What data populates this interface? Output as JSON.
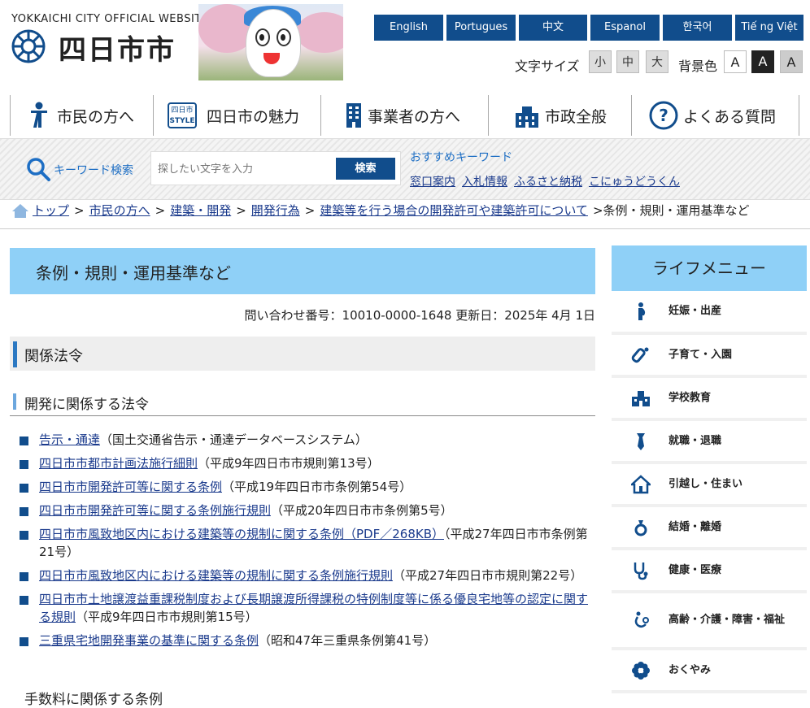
{
  "header": {
    "site_english": "YOKKAICHI CITY OFFICIAL WEBSITE",
    "site_title": "四日市市",
    "languages": [
      "English",
      "Portugues",
      "中文",
      "Espanol",
      "한국어",
      "Tiế ng Việt"
    ],
    "font_size_label": "文字サイズ",
    "font_sizes": [
      "小",
      "中",
      "大"
    ],
    "bg_label": "背景色",
    "bg_options": [
      "A",
      "A",
      "A"
    ]
  },
  "nav": {
    "items": [
      "市民の方へ",
      "四日市の魅力",
      "事業者の方へ",
      "市政全般",
      "よくある質問"
    ],
    "style_badge_top": "四日市",
    "style_badge_bottom": "STYLE"
  },
  "search": {
    "label": "キーワード検索",
    "placeholder": "探したい文字を入力",
    "button": "検索",
    "recommended_title": "おすすめキーワード",
    "recommended": [
      "窓口案内",
      "入札情報",
      "ふるさと納税",
      "こにゅうどうくん"
    ]
  },
  "breadcrumb": {
    "links": [
      "トップ",
      "市民の方へ",
      "建築・開発",
      "開発行為",
      "建築等を行う場合の開発許可や建築許可について"
    ],
    "current": "条例・規則・運用基準など",
    "separator": ">"
  },
  "page": {
    "title": "条例・規則・運用基準など",
    "meta": "問い合わせ番号：10010-0000-1648 更新日：2025年 4月 1日",
    "section_title": "関係法令",
    "subsection_title": "開発に関係する法令",
    "laws": [
      {
        "link": "告示・通達",
        "note": "（国土交通省告示・通達データベースシステム）"
      },
      {
        "link": "四日市市都市計画法施行細則",
        "note": "（平成9年四日市市規則第13号）"
      },
      {
        "link": "四日市市開発許可等に関する条例",
        "note": "（平成19年四日市市条例第54号）"
      },
      {
        "link": "四日市市開発許可等に関する条例施行規則",
        "note": "（平成20年四日市市条例第5号）"
      },
      {
        "link": "四日市市風致地区内における建築等の規制に関する条例（PDF／268KB）",
        "note": "（平成27年四日市市条例第21号）"
      },
      {
        "link": "四日市市風致地区内における建築等の規制に関する条例施行規則",
        "note": "（平成27年四日市市規則第22号）"
      },
      {
        "link": "四日市市土地譲渡益重課税制度および長期譲渡所得課税の特例制度等に係る優良宅地等の認定に関する規則",
        "note": "（平成9年四日市市規則第15号）"
      },
      {
        "link": "三重県宅地開発事業の基準に関する条例",
        "note": "（昭和47年三重県条例第41号）"
      }
    ],
    "next_heading": "手数料に関係する条例"
  },
  "life_menu": {
    "title": "ライフメニュー",
    "items": [
      "妊娠・出産",
      "子育て・入園",
      "学校教育",
      "就職・退職",
      "引越し・住まい",
      "結婚・離婚",
      "健康・医療",
      "高齢・介護・障害・福祉",
      "おくやみ"
    ],
    "icons": [
      "pregnancy-icon",
      "baby-bottle-icon",
      "school-icon",
      "necktie-icon",
      "house-icon",
      "ring-icon",
      "stethoscope-icon",
      "elderly-care-icon",
      "flower-icon"
    ]
  },
  "colors": {
    "brand_blue": "#114d8c",
    "light_blue": "#8fd0f7",
    "link": "#1a3a8c"
  }
}
